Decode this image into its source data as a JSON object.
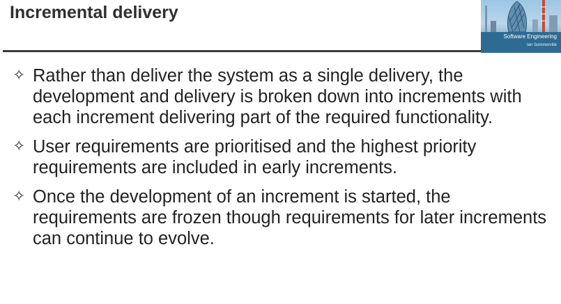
{
  "slide": {
    "title": "Incremental delivery"
  },
  "book_cover": {
    "title": "Software Engineering",
    "author": "Ian Sommerville"
  },
  "bullet_marker": "✧",
  "bullets": [
    {
      "text": "Rather than deliver the system as a single delivery, the development and delivery is broken down into increments with each increment delivering part of the required functionality."
    },
    {
      "text": "User requirements are prioritised and the highest priority requirements are included in early increments."
    },
    {
      "text": "Once the development of an increment is started, the requirements are frozen though requirements for later increments can continue to evolve."
    }
  ]
}
